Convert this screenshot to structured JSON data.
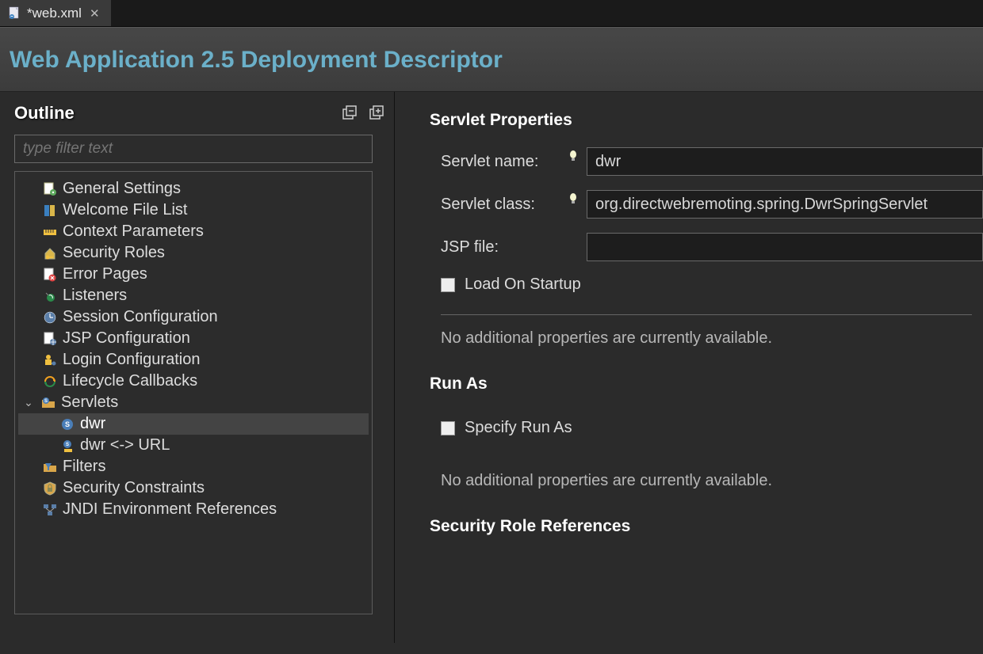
{
  "tab": {
    "title": "*web.xml"
  },
  "header": {
    "title": "Web Application 2.5 Deployment Descriptor"
  },
  "outline": {
    "title": "Outline",
    "filter_placeholder": "type filter text",
    "items": {
      "general": "General Settings",
      "welcome": "Welcome File List",
      "context": "Context Parameters",
      "secroles": "Security Roles",
      "error": "Error Pages",
      "listeners": "Listeners",
      "session": "Session Configuration",
      "jsp": "JSP Configuration",
      "login": "Login Configuration",
      "lifecycle": "Lifecycle Callbacks",
      "servlets": "Servlets",
      "servlet_dwr": "dwr",
      "mapping_dwr": "dwr <-> URL",
      "filters": "Filters",
      "seccons": "Security Constraints",
      "jndi": "JNDI Environment References"
    }
  },
  "details": {
    "servlet_props": {
      "title": "Servlet Properties",
      "name_label": "Servlet name:",
      "name_value": "dwr",
      "class_label": "Servlet class:",
      "class_value": "org.directwebremoting.spring.DwrSpringServlet",
      "jsp_label": "JSP file:",
      "jsp_value": "",
      "load_on_startup": "Load On Startup",
      "no_additional": "No additional properties are currently available."
    },
    "run_as": {
      "title": "Run As",
      "specify": "Specify Run As",
      "no_additional": "No additional properties are currently available."
    },
    "sec_role_refs": {
      "title": "Security Role References"
    }
  }
}
